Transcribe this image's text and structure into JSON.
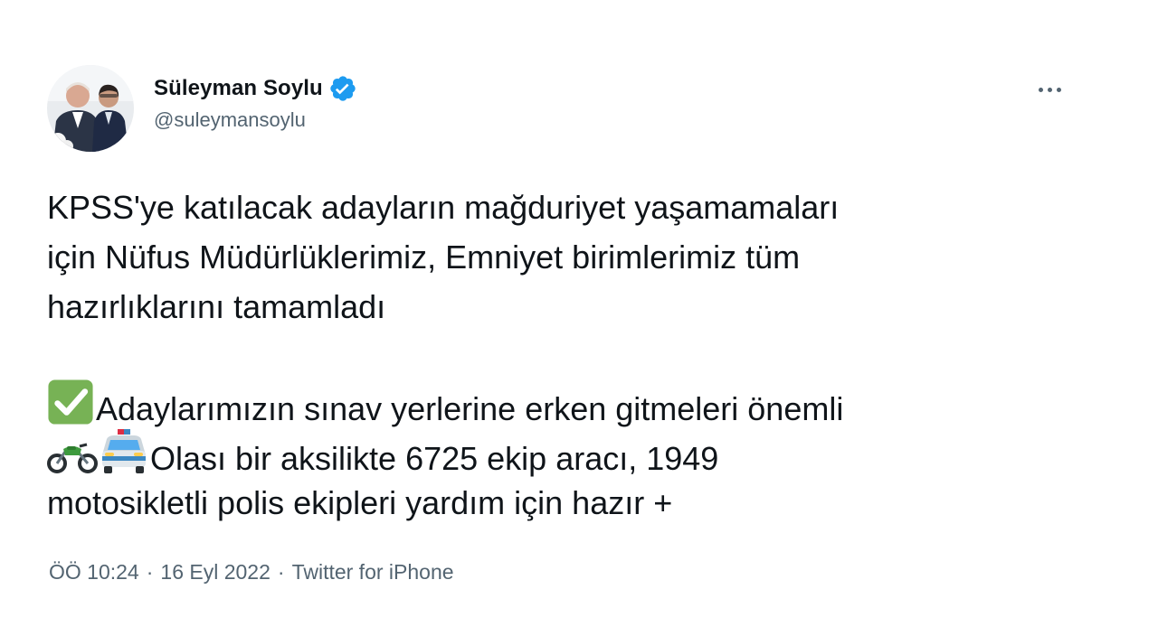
{
  "author": {
    "display_name": "Süleyman Soylu",
    "handle": "@suleymansoylu",
    "verified_icon": "verified-badge-icon",
    "avatar": "profile-photo"
  },
  "more_menu_icon": "more-horizontal-icon",
  "tweet": {
    "paragraph1": [
      "KPSS'ye katılacak adayların mağduriyet yaşamamaları",
      "için Nüfus Müdürlüklerimiz, Emniyet birimlerimiz tüm",
      "hazırlıklarını tamamladı"
    ],
    "line_check": "Adaylarımızın sınav yerlerine erken gitmeleri önemli",
    "line_police": "Olası bir aksilikte 6725 ekip aracı, 1949",
    "line_last": "motosikletli polis ekipleri yardım için hazır +",
    "emoji": {
      "check": "check-mark-button-icon",
      "motorcycle": "motorcycle-icon",
      "police_car": "oncoming-police-car-icon"
    }
  },
  "meta": {
    "time": "ÖÖ 10:24",
    "date": "16 Eyl 2022",
    "separator": "·",
    "source": "Twitter for iPhone"
  },
  "colors": {
    "text": "#0f1419",
    "secondary": "#536471",
    "verified": "#1d9bf0",
    "check_green": "#77b255"
  }
}
